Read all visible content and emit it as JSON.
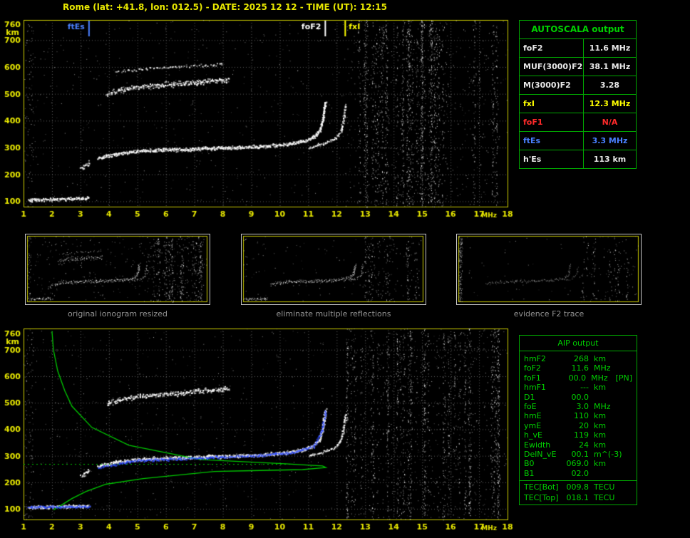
{
  "header": {
    "title": "Rome (lat: +41.8, lon: 012.5) - DATE: 2025 12 12 - TIME (UT): 12:15"
  },
  "autoscala": {
    "title": "AUTOSCALA output",
    "rows": [
      {
        "label": "foF2",
        "value": "11.6 MHz",
        "color": "#e8e8e8"
      },
      {
        "label": "MUF(3000)F2",
        "value": "38.1 MHz",
        "color": "#e8e8e8"
      },
      {
        "label": "M(3000)F2",
        "value": "3.28",
        "color": "#e8e8e8"
      },
      {
        "label": "fxI",
        "value": "12.3 MHz",
        "color": "#ffff00"
      },
      {
        "label": "foF1",
        "value": "N/A",
        "color": "#ff2a2a"
      },
      {
        "label": "ftEs",
        "value": "3.3 MHz",
        "color": "#4a80ff"
      },
      {
        "label": "h'Es",
        "value": "113   km",
        "color": "#e8e8e8"
      }
    ]
  },
  "thumbnails": [
    {
      "caption": "original ionogram resized"
    },
    {
      "caption": "eliminate multiple reflections"
    },
    {
      "caption": "evidence F2 trace"
    }
  ],
  "aip": {
    "title": "AIP output",
    "rows": [
      {
        "name": "hmF2",
        "value": "268",
        "unit": "km",
        "note": ""
      },
      {
        "name": "foF2",
        "value": "11.6",
        "unit": "MHz",
        "note": ""
      },
      {
        "name": "foF1",
        "value": "00.0",
        "unit": "MHz",
        "note": "[PN]"
      },
      {
        "name": "hmF1",
        "value": "---",
        "unit": "km",
        "note": ""
      },
      {
        "name": "D1",
        "value": "00.0",
        "unit": "",
        "note": ""
      },
      {
        "name": "foE",
        "value": "3.0",
        "unit": "MHz",
        "note": ""
      },
      {
        "name": "hmE",
        "value": "110",
        "unit": "km",
        "note": ""
      },
      {
        "name": "ymE",
        "value": "20",
        "unit": "km",
        "note": ""
      },
      {
        "name": "h_vE",
        "value": "119",
        "unit": "km",
        "note": ""
      },
      {
        "name": "Ewidth",
        "value": "24",
        "unit": "km",
        "note": ""
      },
      {
        "name": "DelN_vE",
        "value": "00.1",
        "unit": "m^(-3)",
        "note": ""
      },
      {
        "name": "B0",
        "value": "069.0",
        "unit": "km",
        "note": ""
      },
      {
        "name": "B1",
        "value": "02.0",
        "unit": "",
        "note": ""
      },
      {
        "name": "TEC[Bot]",
        "value": "009.8",
        "unit": "TECU",
        "note": "",
        "sep": true
      },
      {
        "name": "TEC[Top]",
        "value": "018.1",
        "unit": "TECU",
        "note": ""
      }
    ]
  },
  "chart_data": [
    {
      "type": "scatter",
      "title": "Rome ionogram 2025-12-12 12:15 UT (autoscaled)",
      "xlabel": "MHz",
      "ylabel": "km",
      "xlim": [
        1,
        18
      ],
      "ylim": [
        80,
        775
      ],
      "x_ticks": [
        1,
        2,
        3,
        4,
        5,
        6,
        7,
        8,
        9,
        10,
        11,
        12,
        13,
        14,
        15,
        16,
        17,
        18
      ],
      "y_ticks": [
        100,
        200,
        300,
        400,
        500,
        600,
        700,
        760
      ],
      "grid": true,
      "frame_color": "#c8c800",
      "label_color": "#e8e800",
      "markers": [
        {
          "label": "ftEs",
          "x": 3.3,
          "color": "#4a80ff",
          "align": "left"
        },
        {
          "label": "foF2",
          "x": 11.6,
          "color": "#ffffff",
          "align": "left"
        },
        {
          "label": "fxI",
          "x": 12.3,
          "color": "#ffff00",
          "align": "right"
        }
      ],
      "traces": [
        {
          "name": "Es layer (h'Es 113 km, ftEs 3.3 MHz)",
          "color": "#ffffff",
          "width": 2.2,
          "density": 1.8,
          "points": [
            [
              1.15,
              106
            ],
            [
              2.2,
              110
            ],
            [
              3.3,
              113
            ]
          ]
        },
        {
          "name": "Es second hop",
          "color": "#ffffff",
          "width": 3,
          "density": 1.4,
          "points": [
            [
              3.0,
              222
            ],
            [
              3.3,
              248
            ]
          ]
        },
        {
          "name": "F2 ordinary trace (foF2 11.6 MHz)",
          "color": "#ffffff",
          "width": 2.4,
          "density": 1.9,
          "points": [
            [
              3.6,
              262
            ],
            [
              4.2,
              278
            ],
            [
              5.0,
              288
            ],
            [
              6.0,
              293
            ],
            [
              7.0,
              296
            ],
            [
              8.0,
              300
            ],
            [
              9.0,
              304
            ],
            [
              9.8,
              309
            ],
            [
              10.4,
              316
            ],
            [
              10.9,
              327
            ],
            [
              11.2,
              342
            ],
            [
              11.4,
              368
            ],
            [
              11.5,
              405
            ],
            [
              11.55,
              445
            ],
            [
              11.6,
              475
            ]
          ]
        },
        {
          "name": "F2 extraordinary trace (fxI 12.3 MHz)",
          "color": "#ffffff",
          "width": 1.8,
          "density": 1.0,
          "points": [
            [
              11.0,
              302
            ],
            [
              11.5,
              315
            ],
            [
              11.9,
              332
            ],
            [
              12.1,
              355
            ],
            [
              12.2,
              385
            ],
            [
              12.25,
              420
            ],
            [
              12.3,
              462
            ]
          ]
        },
        {
          "name": "F2 multiple reflection",
          "color": "#ffffff",
          "width": 3.5,
          "density": 1.5,
          "points": [
            [
              3.9,
              498
            ],
            [
              4.4,
              515
            ],
            [
              5.0,
              526
            ],
            [
              5.8,
              534
            ],
            [
              6.8,
              542
            ],
            [
              7.6,
              549
            ],
            [
              8.2,
              553
            ]
          ]
        },
        {
          "name": "F2 multiple faint",
          "color": "#ffffff",
          "width": 2,
          "density": 0.45,
          "points": [
            [
              4.2,
              585
            ],
            [
              6.0,
              600
            ],
            [
              8.0,
              612
            ]
          ]
        }
      ],
      "noise": {
        "rfi_band": [
          12.35,
          17.7
        ],
        "left_band": [
          1.03,
          1.35
        ],
        "background": "sparse speckle"
      }
    },
    {
      "type": "scatter",
      "title": "Rome ionogram with AIP inversion profile",
      "xlabel": "MHz",
      "ylabel": "km",
      "xlim": [
        1,
        18
      ],
      "ylim": [
        60,
        780
      ],
      "x_ticks": [
        1,
        2,
        3,
        4,
        5,
        6,
        7,
        8,
        9,
        10,
        11,
        12,
        13,
        14,
        15,
        16,
        17,
        18
      ],
      "y_ticks": [
        100,
        200,
        300,
        400,
        500,
        600,
        700,
        760
      ],
      "grid": true,
      "frame_color": "#c8c800",
      "label_color": "#e8e800",
      "markers": [],
      "traces": [
        {
          "name": "Es layer",
          "color": "#ffffff",
          "width": 2.2,
          "density": 1.8,
          "points": [
            [
              1.15,
              106
            ],
            [
              2.2,
              110
            ],
            [
              3.3,
              113
            ]
          ]
        },
        {
          "name": "Es second hop",
          "color": "#ffffff",
          "width": 3,
          "density": 1.4,
          "points": [
            [
              3.0,
              222
            ],
            [
              3.3,
              248
            ]
          ]
        },
        {
          "name": "F2 ordinary trace",
          "color": "#ffffff",
          "width": 2.4,
          "density": 1.9,
          "points": [
            [
              3.6,
              262
            ],
            [
              4.2,
              278
            ],
            [
              5.0,
              288
            ],
            [
              6.0,
              293
            ],
            [
              7.0,
              296
            ],
            [
              8.0,
              300
            ],
            [
              9.0,
              304
            ],
            [
              9.8,
              309
            ],
            [
              10.4,
              316
            ],
            [
              10.9,
              327
            ],
            [
              11.2,
              342
            ],
            [
              11.4,
              368
            ],
            [
              11.5,
              405
            ],
            [
              11.55,
              445
            ],
            [
              11.6,
              475
            ]
          ]
        },
        {
          "name": "F2 extraordinary trace",
          "color": "#ffffff",
          "width": 1.8,
          "density": 1.0,
          "points": [
            [
              11.0,
              302
            ],
            [
              11.5,
              315
            ],
            [
              11.9,
              332
            ],
            [
              12.1,
              355
            ],
            [
              12.2,
              385
            ],
            [
              12.25,
              420
            ],
            [
              12.3,
              462
            ]
          ]
        },
        {
          "name": "F2 multiple reflection",
          "color": "#ffffff",
          "width": 3.5,
          "density": 1.5,
          "points": [
            [
              3.9,
              498
            ],
            [
              4.4,
              515
            ],
            [
              5.0,
              526
            ],
            [
              5.8,
              534
            ],
            [
              6.8,
              542
            ],
            [
              7.6,
              549
            ],
            [
              8.2,
              553
            ]
          ]
        }
      ],
      "profile": {
        "name": "electron density profile (hmF2 268 km, foF2 11.6 MHz)",
        "color": "#00c800",
        "solid": [
          [
            2.0,
            770
          ],
          [
            2.05,
            700
          ],
          [
            2.2,
            620
          ],
          [
            2.45,
            545
          ],
          [
            2.7,
            487
          ],
          [
            3.4,
            407
          ],
          [
            4.7,
            340
          ],
          [
            7.2,
            286
          ],
          [
            10.2,
            270
          ],
          [
            11.5,
            262
          ],
          [
            11.62,
            256
          ],
          [
            10.8,
            248
          ],
          [
            9.0,
            244
          ],
          [
            7.7,
            241
          ],
          [
            5.2,
            214
          ],
          [
            3.9,
            193
          ],
          [
            3.2,
            166
          ],
          [
            2.7,
            139
          ],
          [
            2.3,
            112
          ],
          [
            2.05,
            96
          ]
        ],
        "dotted": [
          [
            1.0,
            268
          ],
          [
            10.6,
            268
          ]
        ]
      },
      "scaled_trace": {
        "name": "autoscaled trace points",
        "color": "#2e4bff",
        "es_points": [
          [
            1.15,
            108
          ],
          [
            3.3,
            111
          ]
        ],
        "f2_points": [
          [
            3.6,
            258
          ],
          [
            5.0,
            284
          ],
          [
            7.0,
            293
          ],
          [
            9.0,
            301
          ],
          [
            10.4,
            313
          ],
          [
            11.2,
            340
          ],
          [
            11.45,
            390
          ],
          [
            11.55,
            440
          ],
          [
            11.6,
            470
          ]
        ]
      },
      "noise": {
        "rfi_band": [
          12.35,
          17.7
        ],
        "left_band": [
          1.03,
          1.35
        ],
        "background": "sparse speckle"
      }
    }
  ]
}
